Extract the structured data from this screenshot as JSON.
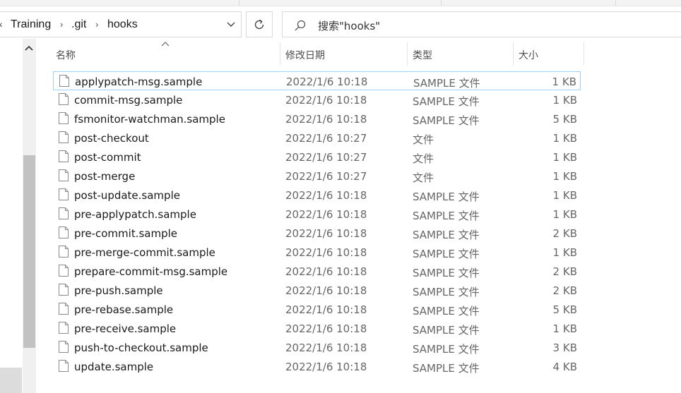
{
  "breadcrumb": {
    "items": [
      "Training",
      ".git",
      "hooks"
    ]
  },
  "search": {
    "placeholder": "搜索\"hooks\""
  },
  "columns": {
    "name": "名称",
    "date": "修改日期",
    "type": "类型",
    "size": "大小"
  },
  "files": [
    {
      "name": "applypatch-msg.sample",
      "date": "2022/1/6 10:18",
      "type": "SAMPLE 文件",
      "size": "1 KB"
    },
    {
      "name": "commit-msg.sample",
      "date": "2022/1/6 10:18",
      "type": "SAMPLE 文件",
      "size": "1 KB"
    },
    {
      "name": "fsmonitor-watchman.sample",
      "date": "2022/1/6 10:18",
      "type": "SAMPLE 文件",
      "size": "5 KB"
    },
    {
      "name": "post-checkout",
      "date": "2022/1/6 10:27",
      "type": "文件",
      "size": "1 KB"
    },
    {
      "name": "post-commit",
      "date": "2022/1/6 10:27",
      "type": "文件",
      "size": "1 KB"
    },
    {
      "name": "post-merge",
      "date": "2022/1/6 10:27",
      "type": "文件",
      "size": "1 KB"
    },
    {
      "name": "post-update.sample",
      "date": "2022/1/6 10:18",
      "type": "SAMPLE 文件",
      "size": "1 KB"
    },
    {
      "name": "pre-applypatch.sample",
      "date": "2022/1/6 10:18",
      "type": "SAMPLE 文件",
      "size": "1 KB"
    },
    {
      "name": "pre-commit.sample",
      "date": "2022/1/6 10:18",
      "type": "SAMPLE 文件",
      "size": "2 KB"
    },
    {
      "name": "pre-merge-commit.sample",
      "date": "2022/1/6 10:18",
      "type": "SAMPLE 文件",
      "size": "1 KB"
    },
    {
      "name": "prepare-commit-msg.sample",
      "date": "2022/1/6 10:18",
      "type": "SAMPLE 文件",
      "size": "2 KB"
    },
    {
      "name": "pre-push.sample",
      "date": "2022/1/6 10:18",
      "type": "SAMPLE 文件",
      "size": "2 KB"
    },
    {
      "name": "pre-rebase.sample",
      "date": "2022/1/6 10:18",
      "type": "SAMPLE 文件",
      "size": "5 KB"
    },
    {
      "name": "pre-receive.sample",
      "date": "2022/1/6 10:18",
      "type": "SAMPLE 文件",
      "size": "1 KB"
    },
    {
      "name": "push-to-checkout.sample",
      "date": "2022/1/6 10:18",
      "type": "SAMPLE 文件",
      "size": "3 KB"
    },
    {
      "name": "update.sample",
      "date": "2022/1/6 10:18",
      "type": "SAMPLE 文件",
      "size": "4 KB"
    }
  ],
  "icons": {
    "file": "file-icon",
    "search": "search-icon",
    "refresh": "refresh-icon",
    "dropdown": "chevron-down-icon",
    "breadcrumb_separator": "chevron-right-icon",
    "sort": "sort-ascending-icon",
    "scroll_up": "chevron-up-icon"
  },
  "colors": {
    "selection_border": "#99d1ff",
    "scrollbar_thumb": "#c2c2c2"
  }
}
